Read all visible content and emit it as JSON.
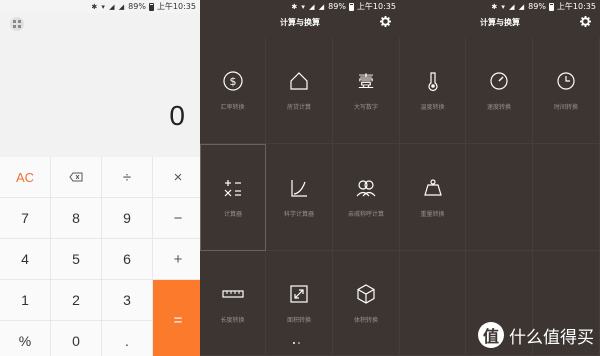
{
  "status": {
    "battery": "89%",
    "time": "上午10:35"
  },
  "calculator": {
    "display": "0",
    "keys": {
      "ac": "AC",
      "backspace": "⌫",
      "divide": "÷",
      "multiply": "×",
      "seven": "7",
      "eight": "8",
      "nine": "9",
      "minus": "−",
      "four": "4",
      "five": "5",
      "six": "6",
      "plus": "+",
      "one": "1",
      "two": "2",
      "three": "3",
      "equals": "=",
      "percent": "%",
      "zero": "0",
      "dot": "."
    }
  },
  "converter": {
    "title": "计算与换算",
    "page1": {
      "tiles": [
        {
          "label": "汇率转换",
          "icon": "currency-icon"
        },
        {
          "label": "房贷计算",
          "icon": "house-icon"
        },
        {
          "label": "大写数字",
          "icon": "chinese-numeral-icon"
        },
        {
          "label": "计算器",
          "icon": "calculator-icon"
        },
        {
          "label": "科学计算器",
          "icon": "graph-curve-icon"
        },
        {
          "label": "亲戚称呼计算",
          "icon": "people-icon"
        },
        {
          "label": "长度转换",
          "icon": "ruler-icon"
        },
        {
          "label": "面积转换",
          "icon": "area-icon"
        },
        {
          "label": "体积转换",
          "icon": "cube-icon"
        }
      ]
    },
    "page2": {
      "tiles": [
        {
          "label": "温度转换",
          "icon": "thermometer-icon"
        },
        {
          "label": "速度转换",
          "icon": "speedometer-icon"
        },
        {
          "label": "时间转换",
          "icon": "clock-icon"
        },
        {
          "label": "重量转换",
          "icon": "weight-icon"
        }
      ]
    }
  },
  "watermark": {
    "text": "什么值得买",
    "logo_char": "值"
  }
}
